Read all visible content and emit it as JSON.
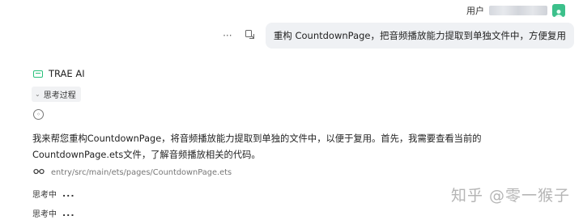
{
  "user": {
    "label": "用户",
    "avatar_color": "#3cc08b"
  },
  "message": {
    "more_icon": "more-icon",
    "action_icon": "copy-to-input-icon",
    "text": "重构 CountdownPage，把音频播放能力提取到单独文件中，方便复用"
  },
  "assistant": {
    "name": "TRAE AI",
    "logo_color": "#28c07a",
    "thinking_toggle": "思考过程",
    "answer_text": "我来帮您重构CountdownPage，将音频播放能力提取到单独的文件中，以便于复用。首先，我需要查看当前的CountdownPage.ets文件，了解音频播放相关的代码。",
    "file_path": "entry/src/main/ets/pages/CountdownPage.ets",
    "thinking_items": [
      {
        "label": "思考中",
        "dots": "..."
      },
      {
        "label": "思考中",
        "dots": "..."
      }
    ]
  },
  "watermark": "知乎 @零一猴子"
}
